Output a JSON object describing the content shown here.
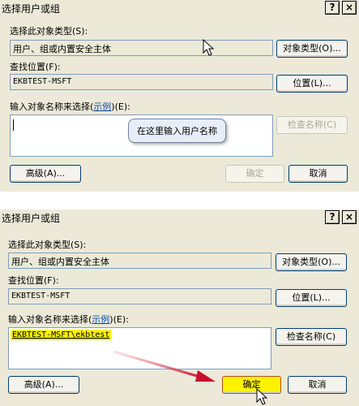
{
  "dialog": {
    "title": "选择用户或组",
    "help_glyph": "?",
    "close_glyph": "×",
    "object_type_label": "选择此对象类型(S):",
    "object_type_value": "用户、组或内置安全主体",
    "object_type_button": "对象类型(O)...",
    "location_label": "查找位置(F):",
    "location_value": "EKBTEST-MSFT",
    "location_button": "位置(L)...",
    "names_label_before": "输入对象名称来选择(",
    "names_label_link": "示例",
    "names_label_after": ")(E):",
    "check_names_button": "检查名称(C)",
    "advanced_button": "高级(A)...",
    "ok_button": "确定",
    "cancel_button": "取消"
  },
  "top": {
    "tooltip_text": "在这里输入用户名称"
  },
  "bottom": {
    "entered_name": "EKBTEST-MSFT\\ekbtest"
  },
  "colors": {
    "dialog_bg": "#ece9d8",
    "highlight": "#fff200",
    "arrow": "#c8102e",
    "link": "#0b4fa8"
  }
}
